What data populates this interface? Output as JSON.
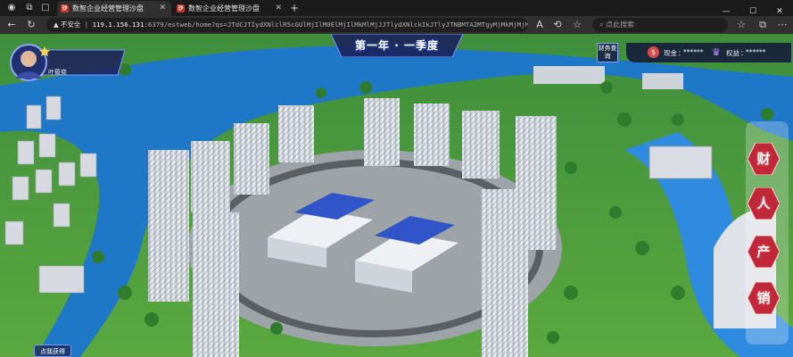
{
  "browser": {
    "tabs": [
      {
        "title": "数智企业经营管理沙盘",
        "active": true
      },
      {
        "title": "数智企业经营管理沙盘",
        "active": false
      }
    ],
    "new_tab_label": "+",
    "address": {
      "security_label": "不安全",
      "host": "119.1.156.131",
      "rest": ":6379/estweb/home?qs=JTdCJTIydXNlclR5cGUlMjIlM0ElMjIlMkMlMjJJTlydXNlckIkJTlyJTNBMTA2MTgyMjMkMjMjMjQ1QjIwMjlwMjJTlydX"
    },
    "search_placeholder": "点此搜索"
  },
  "hud": {
    "title": "第一年 · 一季度",
    "user_name": "叶筱奕",
    "finance_button": "财务查询",
    "cash_label": "现金",
    "cash_value": "******",
    "equity_label": "权益",
    "equity_value": "******",
    "side_buttons": [
      {
        "label": "财",
        "name": "side-button-finance"
      },
      {
        "label": "人",
        "name": "side-button-people"
      },
      {
        "label": "产",
        "name": "side-button-production"
      },
      {
        "label": "销",
        "name": "side-button-sales"
      }
    ],
    "bottom_button": "点我获得"
  },
  "colors": {
    "river": "#1f77c8",
    "grass": "#6fbf4a",
    "hud_panel": "#1e2356",
    "accent": "#6a8cff"
  }
}
